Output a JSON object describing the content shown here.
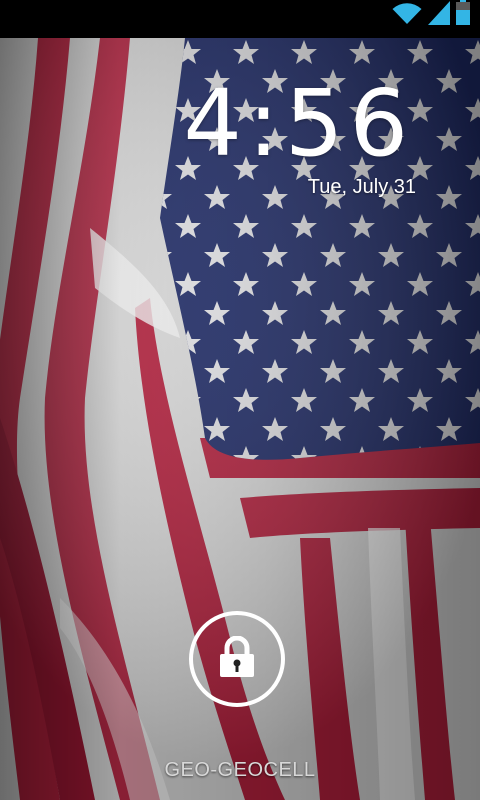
{
  "status_bar": {
    "icons": [
      "wifi-icon",
      "signal-icon",
      "battery-icon"
    ],
    "accent_color": "#33b5e5"
  },
  "lockscreen": {
    "time": "4:56",
    "date": "Tue, July 31",
    "carrier": "GEO-GEOCELL",
    "unlock_icon": "lock-icon"
  },
  "wallpaper": {
    "subject": "american-flag",
    "colors": {
      "red": "#b3203d",
      "white": "#e6e6e6",
      "blue": "#1e2a66",
      "star": "#eeeeee"
    }
  }
}
